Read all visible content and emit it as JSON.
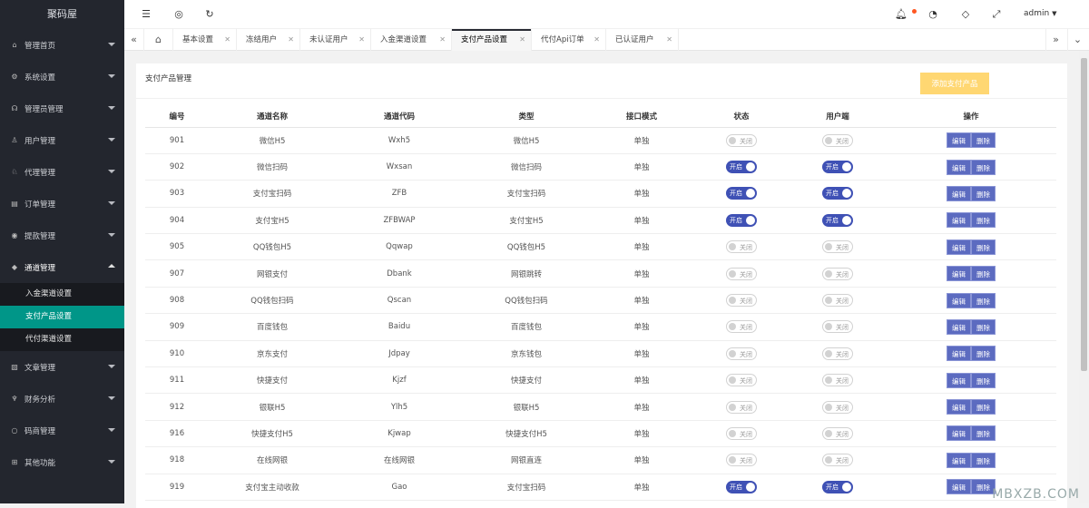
{
  "sidebar": {
    "logo": "聚码屋",
    "menu": [
      {
        "icon": "⌂",
        "label": "管理首页"
      },
      {
        "icon": "⚙",
        "label": "系统设置"
      },
      {
        "icon": "☊",
        "label": "管理员管理"
      },
      {
        "icon": "♙",
        "label": "用户管理"
      },
      {
        "icon": "♘",
        "label": "代理管理"
      },
      {
        "icon": "▤",
        "label": "订单管理"
      },
      {
        "icon": "◉",
        "label": "提款管理"
      },
      {
        "icon": "◆",
        "label": "通道管理"
      },
      {
        "icon": "▧",
        "label": "文章管理"
      },
      {
        "icon": "♆",
        "label": "财务分析"
      },
      {
        "icon": "○",
        "label": "码商管理"
      },
      {
        "icon": "⊞",
        "label": "其他功能"
      }
    ],
    "submenu": [
      "入金渠道设置",
      "支付产品设置",
      "代付渠道设置"
    ]
  },
  "header": {
    "user": "admin",
    "icons": [
      "menu-fold-icon",
      "globe-icon",
      "refresh-icon",
      "bell-icon",
      "theme-icon",
      "tag-icon",
      "fullscreen-icon"
    ]
  },
  "tabs": [
    "基本设置",
    "冻结用户",
    "未认证用户",
    "入金渠道设置",
    "支付产品设置",
    "代付Api订单",
    "已认证用户"
  ],
  "card": {
    "title": "支付产品管理",
    "add_button": "添加支付产品"
  },
  "table": {
    "headers": [
      "编号",
      "通道名称",
      "通道代码",
      "类型",
      "接口模式",
      "状态",
      "用户端",
      "操作"
    ],
    "on_label": "开启",
    "off_label": "关闭",
    "edit_label": "编辑",
    "delete_label": "删除",
    "rows": [
      {
        "id": "901",
        "name": "微信H5",
        "code": "Wxh5",
        "type": "微信H5",
        "mode": "单独",
        "status": false,
        "user": false
      },
      {
        "id": "902",
        "name": "微信扫码",
        "code": "Wxsan",
        "type": "微信扫码",
        "mode": "单独",
        "status": true,
        "user": true
      },
      {
        "id": "903",
        "name": "支付宝扫码",
        "code": "ZFB",
        "type": "支付宝扫码",
        "mode": "单独",
        "status": true,
        "user": true
      },
      {
        "id": "904",
        "name": "支付宝H5",
        "code": "ZFBWAP",
        "type": "支付宝H5",
        "mode": "单独",
        "status": true,
        "user": true
      },
      {
        "id": "905",
        "name": "QQ钱包H5",
        "code": "Qqwap",
        "type": "QQ钱包H5",
        "mode": "单独",
        "status": false,
        "user": false
      },
      {
        "id": "907",
        "name": "网银支付",
        "code": "Dbank",
        "type": "网银跳转",
        "mode": "单独",
        "status": false,
        "user": false
      },
      {
        "id": "908",
        "name": "QQ钱包扫码",
        "code": "Qscan",
        "type": "QQ钱包扫码",
        "mode": "单独",
        "status": false,
        "user": false
      },
      {
        "id": "909",
        "name": "百度钱包",
        "code": "Baidu",
        "type": "百度钱包",
        "mode": "单独",
        "status": false,
        "user": false
      },
      {
        "id": "910",
        "name": "京东支付",
        "code": "Jdpay",
        "type": "京东钱包",
        "mode": "单独",
        "status": false,
        "user": false
      },
      {
        "id": "911",
        "name": "快捷支付",
        "code": "Kjzf",
        "type": "快捷支付",
        "mode": "单独",
        "status": false,
        "user": false
      },
      {
        "id": "912",
        "name": "银联H5",
        "code": "Ylh5",
        "type": "银联H5",
        "mode": "单独",
        "status": false,
        "user": false
      },
      {
        "id": "916",
        "name": "快捷支付H5",
        "code": "Kjwap",
        "type": "快捷支付H5",
        "mode": "单独",
        "status": false,
        "user": false
      },
      {
        "id": "918",
        "name": "在线网银",
        "code": "在线网银",
        "type": "网银直连",
        "mode": "单独",
        "status": false,
        "user": false
      },
      {
        "id": "919",
        "name": "支付宝主动收款",
        "code": "Gao",
        "type": "支付宝扫码",
        "mode": "单独",
        "status": true,
        "user": true
      }
    ]
  },
  "watermark": "MBXZB.COM"
}
